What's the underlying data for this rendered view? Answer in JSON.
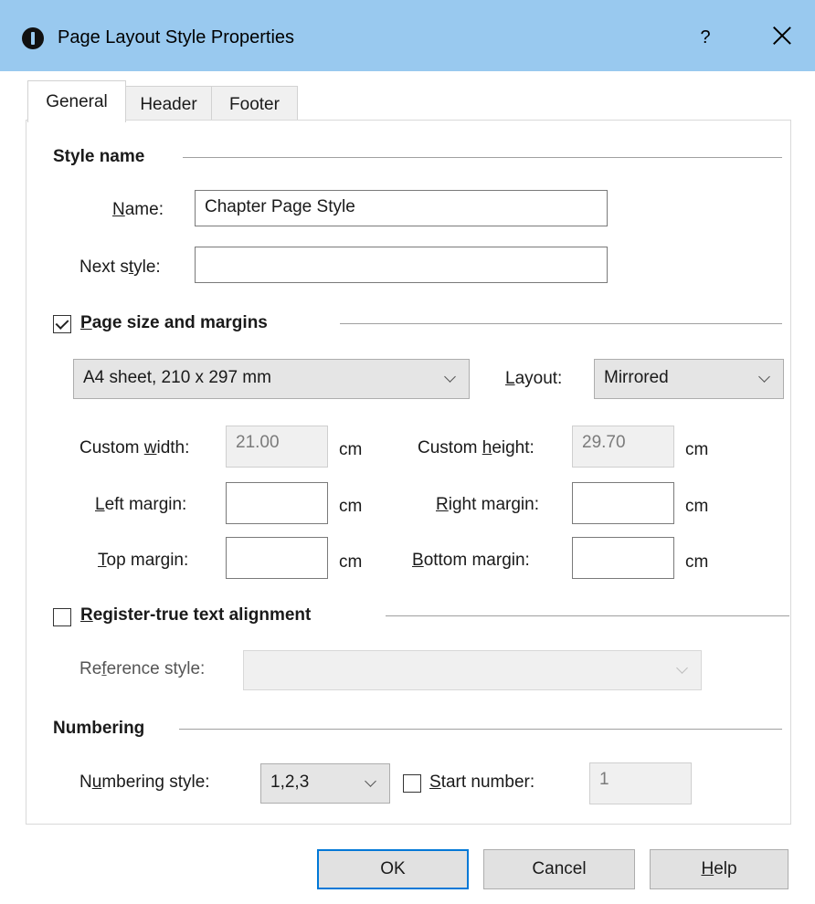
{
  "window": {
    "title": "Page Layout Style Properties",
    "help_glyph": "?",
    "accent_color": "#99c9ef"
  },
  "tabs": [
    {
      "label": "General",
      "active": true
    },
    {
      "label": "Header",
      "active": false
    },
    {
      "label": "Footer",
      "active": false
    }
  ],
  "style_name": {
    "group_title": "Style name",
    "name_label_u": "N",
    "name_label_rest": "ame:",
    "name_value": "Chapter Page Style",
    "next_label_pre": "Next s",
    "next_label_u": "t",
    "next_label_post": "yle:",
    "next_value": ""
  },
  "page_size": {
    "checked": true,
    "group_title_u": "P",
    "group_title_rest": "age size and margins",
    "sheet_selected": "A4 sheet, 210 x 297 mm",
    "layout_label_u": "L",
    "layout_label_rest": "ayout:",
    "layout_selected": "Mirrored",
    "custom_width_pre": "Custom ",
    "custom_width_u": "w",
    "custom_width_post": "idth:",
    "custom_width_value": "21.00",
    "custom_height_pre": "Custom ",
    "custom_height_u": "h",
    "custom_height_post": "eight:",
    "custom_height_value": "29.70",
    "left_u": "L",
    "left_rest": "eft margin:",
    "right_u": "R",
    "right_rest": "ight margin:",
    "top_u": "T",
    "top_rest": "op margin:",
    "bottom_u": "B",
    "bottom_rest": "ottom margin:",
    "unit": "cm"
  },
  "register_true": {
    "checked": false,
    "group_title_u": "R",
    "group_title_rest": "egister-true text alignment",
    "ref_label_pre": "Re",
    "ref_label_u": "f",
    "ref_label_post": "erence style:",
    "ref_value": ""
  },
  "numbering": {
    "group_title": "Numbering",
    "style_label_pre": "N",
    "style_label_u": "u",
    "style_label_post": "mbering style:",
    "style_selected": "1,2,3",
    "start_label_u": "S",
    "start_label_rest": "tart number:",
    "start_checked": false,
    "start_value": "1"
  },
  "buttons": {
    "ok": "OK",
    "cancel": "Cancel",
    "help_u": "H",
    "help_rest": "elp"
  }
}
